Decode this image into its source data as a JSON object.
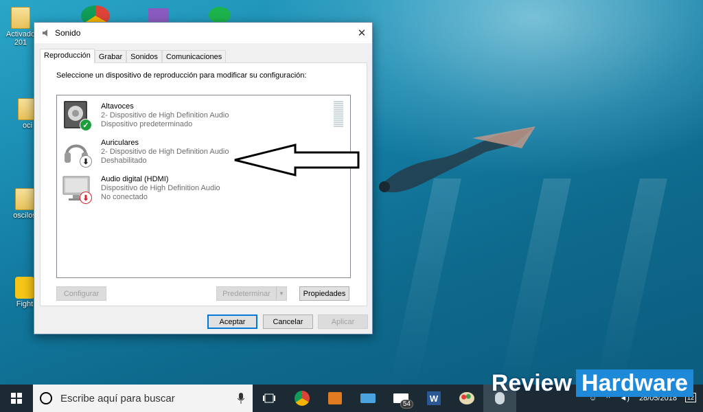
{
  "desktop": {
    "icons": [
      {
        "label": "Activado 201",
        "icon": "folder-icon"
      },
      {
        "label": "oci",
        "icon": "folder-icon"
      },
      {
        "label": "oscilos",
        "icon": "folder-icon"
      },
      {
        "label": "Fight",
        "icon": "game-shortcut-icon"
      }
    ]
  },
  "dialog": {
    "title": "Sonido",
    "close_glyph": "✕",
    "tabs": [
      {
        "label": "Reproducción",
        "active": true
      },
      {
        "label": "Grabar",
        "active": false
      },
      {
        "label": "Sonidos",
        "active": false
      },
      {
        "label": "Comunicaciones",
        "active": false
      }
    ],
    "instruction": "Seleccione un dispositivo de reproducción para modificar su configuración:",
    "devices": [
      {
        "name": "Altavoces",
        "line2": "2- Dispositivo de High Definition Audio",
        "line3": "Dispositivo predeterminado",
        "icon": "speaker-icon",
        "status_icon": "check-icon",
        "status_color": "#1e9e3a"
      },
      {
        "name": "Auriculares",
        "line2": "2- Dispositivo de High Definition Audio",
        "line3": "Deshabilitado",
        "icon": "headphones-icon",
        "status_icon": "down-arrow-icon",
        "status_color": "#333333"
      },
      {
        "name": "Audio digital (HDMI)",
        "line2": "Dispositivo de High Definition Audio",
        "line3": "No conectado",
        "icon": "monitor-icon",
        "status_icon": "down-arrow-icon",
        "status_color": "#d9202a"
      }
    ],
    "buttons": {
      "configure": "Configurar",
      "set_default": "Predeterminar",
      "properties": "Propiedades",
      "ok": "Aceptar",
      "cancel": "Cancelar",
      "apply": "Aplicar"
    }
  },
  "taskbar": {
    "search_placeholder": "Escribe aquí para buscar",
    "pinned": [
      "task-view-icon",
      "chrome-icon",
      "media-player-icon",
      "laptop-icon",
      "mail-icon",
      "word-icon",
      "paint-icon",
      "sound-app-icon"
    ],
    "mail_count": "54",
    "date": "28/05/2018",
    "notification_count": "12"
  },
  "watermark": {
    "part1": "Review",
    "part2": "Hardware"
  },
  "colors": {
    "accent": "#0078d7",
    "taskbar": "#1b2a33",
    "watermark_blue": "#1e88d9"
  }
}
